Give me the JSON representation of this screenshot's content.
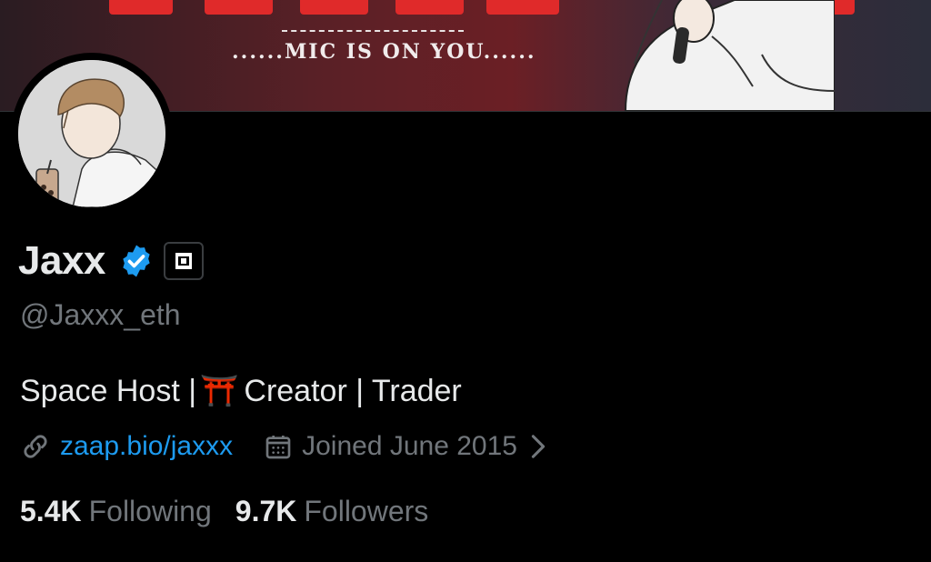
{
  "banner": {
    "tagline": "......MIC IS ON YOU......"
  },
  "profile": {
    "display_name": "Jaxx",
    "handle": "@Jaxxx_eth",
    "bio_before": "Space Host |",
    "bio_emoji": "⛩️",
    "bio_after": " Creator | Trader",
    "link_text": "zaap.bio/jaxxx",
    "joined_text": "Joined June 2015",
    "following_count": "5.4K",
    "following_label": "Following",
    "followers_count": "9.7K",
    "followers_label": "Followers"
  },
  "icons": {
    "verified": "verified-badge-icon",
    "affiliate": "affiliate-badge-icon",
    "link": "link-icon",
    "calendar": "calendar-icon",
    "chevron": "chevron-right-icon"
  },
  "colors": {
    "background": "#000000",
    "text_primary": "#e7e9ea",
    "text_secondary": "#71767b",
    "link": "#1d9bf0",
    "verified": "#1d9bf0"
  }
}
